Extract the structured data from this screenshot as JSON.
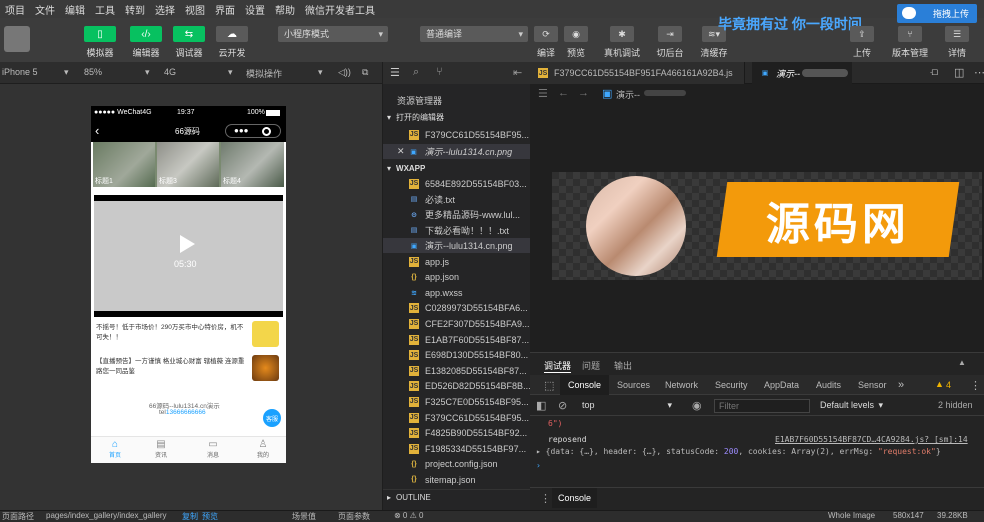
{
  "menubar": [
    "项目",
    "文件",
    "编辑",
    "工具",
    "转到",
    "选择",
    "视图",
    "界面",
    "设置",
    "帮助",
    "微信开发者工具"
  ],
  "toolbar": {
    "simulator_label": "模拟器",
    "editor_label": "编辑器",
    "debugger_label": "调试器",
    "cloud_label": "云开发",
    "mode_select": "小程序模式",
    "compile_select": "普通编译",
    "compile_label": "编译",
    "preview_label": "预览",
    "real_debug_label": "真机调试",
    "switch_bg_label": "切后台",
    "clear_cache_label": "清缓存",
    "upload_label": "上传",
    "version_label": "版本管理",
    "detail_label": "详情",
    "banner_text": "毕竟拥有过 你一段时间",
    "drag_upload": "拖拽上传"
  },
  "sim_bar": {
    "device": "iPhone 5",
    "zoom": "85%",
    "network": "4G",
    "operation": "模拟操作"
  },
  "phone": {
    "carrier": "●●●●● WeChat4G",
    "time": "19:37",
    "battery": "100%",
    "title": "66源码",
    "thumbs": [
      "标题1",
      "标题3",
      "标题4"
    ],
    "video_time": "05:30",
    "news": [
      {
        "text": "不摇号！低于市场价！290万买市中心特价房，机不可失！！"
      },
      {
        "text": "【直播预告】一方谨慎 格业城心财富 辖植薇 连源重路您一同品鉴"
      }
    ],
    "footer_line1": "66源码--lulu1314.cn演示",
    "footer_tel_prefix": "tel",
    "footer_tel": "13666666666",
    "fab": "客服",
    "tabbar": [
      "首页",
      "资讯",
      "消息",
      "我的"
    ]
  },
  "explorer": {
    "title": "资源管理器",
    "open_editors": "打开的编辑器",
    "open_files": [
      "F379CC61D55154BF95...",
      "演示--lulu1314.cn.png"
    ],
    "wxapp": "WXAPP",
    "files": [
      {
        "name": "6584E892D55154BF03...",
        "type": "js"
      },
      {
        "name": "必读.txt",
        "type": "txt"
      },
      {
        "name": "更多精品源码-www.lul...",
        "type": "link"
      },
      {
        "name": "下载必看呦！！！.txt",
        "type": "txt"
      },
      {
        "name": "演示--lulu1314.cn.png",
        "type": "png"
      },
      {
        "name": "app.js",
        "type": "js"
      },
      {
        "name": "app.json",
        "type": "json"
      },
      {
        "name": "app.wxss",
        "type": "wxss"
      },
      {
        "name": "C0289973D55154BFA6...",
        "type": "js"
      },
      {
        "name": "CFE2F307D55154BFA9...",
        "type": "js"
      },
      {
        "name": "E1AB7F60D55154BF87...",
        "type": "js"
      },
      {
        "name": "E698D130D55154BF80...",
        "type": "js"
      },
      {
        "name": "E1382085D55154BF87...",
        "type": "js"
      },
      {
        "name": "ED526D82D55154BF8B...",
        "type": "js"
      },
      {
        "name": "F325C7E0D55154BF95...",
        "type": "js"
      },
      {
        "name": "F379CC61D55154BF95...",
        "type": "js"
      },
      {
        "name": "F4825B90D55154BF92...",
        "type": "js"
      },
      {
        "name": "F1985334D55154BF97...",
        "type": "js"
      },
      {
        "name": "project.config.json",
        "type": "json"
      },
      {
        "name": "sitemap.json",
        "type": "json"
      }
    ],
    "outline": "OUTLINE"
  },
  "editor": {
    "tab1": "F379CC61D55154BF951FA466161A92B4.js",
    "tab2": "演示--",
    "breadcrumb": "演示--",
    "watermark": "源码网"
  },
  "console": {
    "tabs": [
      "调试器",
      "问题",
      "输出"
    ],
    "devtabs": [
      "Console",
      "Sources",
      "Network",
      "Security",
      "AppData",
      "Audits",
      "Sensor"
    ],
    "warn_count": "4",
    "context": "top",
    "filter_placeholder": "Filter",
    "levels": "Default levels",
    "hidden": "2 hidden",
    "line0": "6\")",
    "log_label": "reposend",
    "log_source": "E1AB7F60D55154BF87CD…4CA9284.js? [sm]:14",
    "log_obj_prefix": "{data: {…}, header: {…}, statusCode: ",
    "log_status": "200",
    "log_obj_mid": ", cookies: Array(2), errMsg: ",
    "log_errmsg": "\"request:ok\"",
    "log_obj_suffix": "}",
    "bottom_tab": "Console"
  },
  "statusline": {
    "path_label": "页面路径",
    "path": "pages/index_gallery/index_gallery",
    "copy": "复制",
    "preview": "预览",
    "scene": "场景值",
    "params": "页面参数",
    "errors": "⊗ 0 ⚠ 0",
    "whole": "Whole Image",
    "dims": "580x147",
    "size": "39.28KB"
  },
  "colors": {
    "green": "#07c160",
    "blue": "#1aa1ff",
    "orange": "#f39a0b"
  }
}
